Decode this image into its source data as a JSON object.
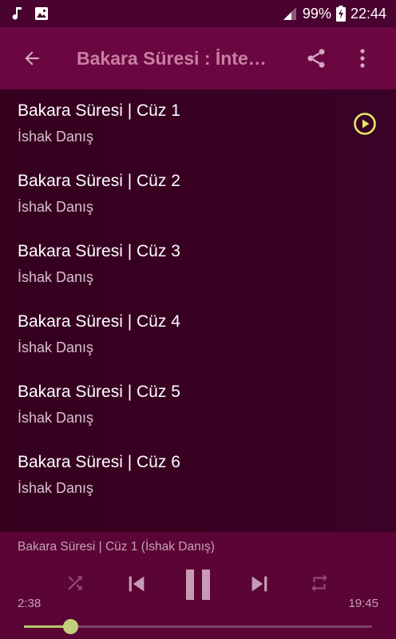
{
  "status_bar": {
    "battery": "99%",
    "time": "22:44",
    "left_icons": [
      "music-note-icon",
      "image-icon"
    ],
    "right_icons": [
      "signal-icon",
      "battery-charging-icon"
    ]
  },
  "app_bar": {
    "title": "Bakara Süresi : İnte…",
    "back_icon": "back-arrow-icon",
    "share_icon": "share-icon",
    "more_icon": "more-vert-icon"
  },
  "tracks": [
    {
      "title": "Bakara Süresi | Cüz 1",
      "artist": "İshak Danış",
      "playing": true
    },
    {
      "title": "Bakara Süresi | Cüz 2",
      "artist": "İshak Danış",
      "playing": false
    },
    {
      "title": "Bakara Süresi | Cüz 3",
      "artist": "İshak Danış",
      "playing": false
    },
    {
      "title": "Bakara Süresi | Cüz 4",
      "artist": "İshak Danış",
      "playing": false
    },
    {
      "title": "Bakara Süresi | Cüz 5",
      "artist": "İshak Danış",
      "playing": false
    },
    {
      "title": "Bakara Süresi | Cüz 6",
      "artist": "İshak Danış",
      "playing": false
    }
  ],
  "player": {
    "now_playing": "Bakara Süresi | Cüz 1 (İshak Danış)",
    "current_time": "2:38",
    "duration": "19:45",
    "progress_fraction": 0.133,
    "controls": [
      "shuffle-icon",
      "skip-previous-icon",
      "pause-icon",
      "skip-next-icon",
      "repeat-icon"
    ]
  },
  "colors": {
    "accent": "#e3e86a",
    "seek_thumb": "#c1d07a",
    "app_bar": "#6a0740",
    "background": "#3a0225"
  }
}
